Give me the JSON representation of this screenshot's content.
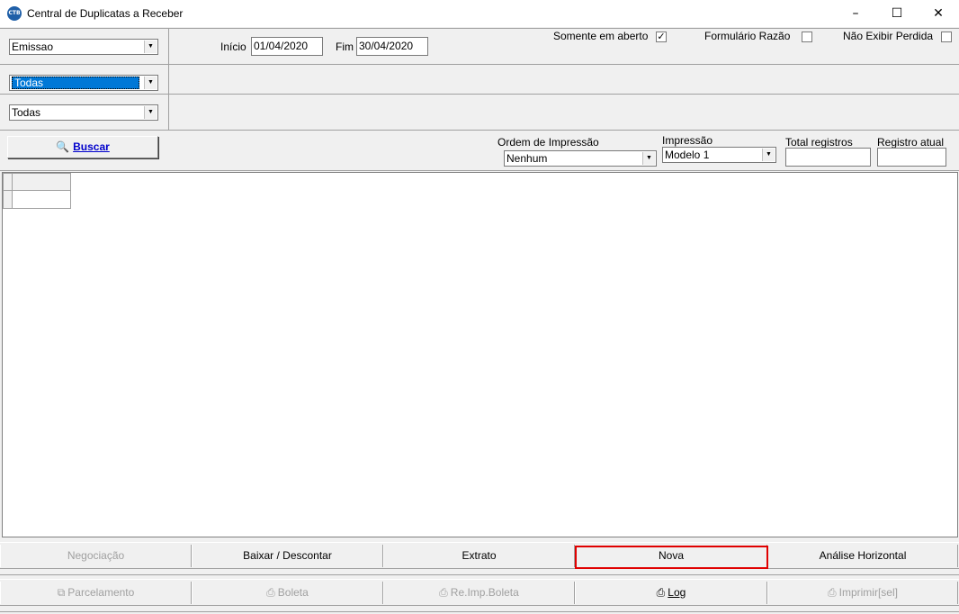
{
  "window": {
    "title": "Central de Duplicatas a Receber",
    "icon_text": "CTB",
    "min": "–",
    "max": "☐",
    "close": "✕"
  },
  "filters": {
    "date_type": "Emissao",
    "inicio_label": "Início",
    "inicio_value": "01/04/2020",
    "fim_label": "Fim",
    "fim_value": "30/04/2020",
    "somente_aberto_label": "Somente em aberto",
    "somente_aberto_checked": "✓",
    "formulario_razao_label": "Formulário Razão",
    "nao_exibir_perdida_label": "Não Exibir Perdida",
    "combo2": "Todas",
    "combo3": "Todas"
  },
  "search": {
    "buscar_label": "Buscar",
    "ordem_label": "Ordem de Impressão",
    "ordem_value": "Nenhum",
    "impressao_label": "Impressão",
    "impressao_value": "Modelo 1",
    "total_label": "Total registros",
    "atual_label": "Registro atual"
  },
  "buttons_row1": [
    {
      "label": "Negociação",
      "enabled": false
    },
    {
      "label": "Baixar / Descontar",
      "enabled": true
    },
    {
      "label": "Extrato",
      "enabled": true
    },
    {
      "label": "Nova",
      "enabled": true
    },
    {
      "label": "Análise Horizontal",
      "enabled": true
    }
  ],
  "buttons_row2": [
    {
      "label": "Parcelamento",
      "enabled": false,
      "icon": "parcelamento-icon"
    },
    {
      "label": "Boleta",
      "enabled": false,
      "icon": "printer-icon"
    },
    {
      "label": "Re.Imp.Boleta",
      "enabled": false,
      "icon": "printer-icon"
    },
    {
      "label": "Log",
      "enabled": true,
      "icon": "printer-icon"
    },
    {
      "label": "Imprimir[sel]",
      "enabled": false,
      "icon": "printer-icon"
    }
  ]
}
